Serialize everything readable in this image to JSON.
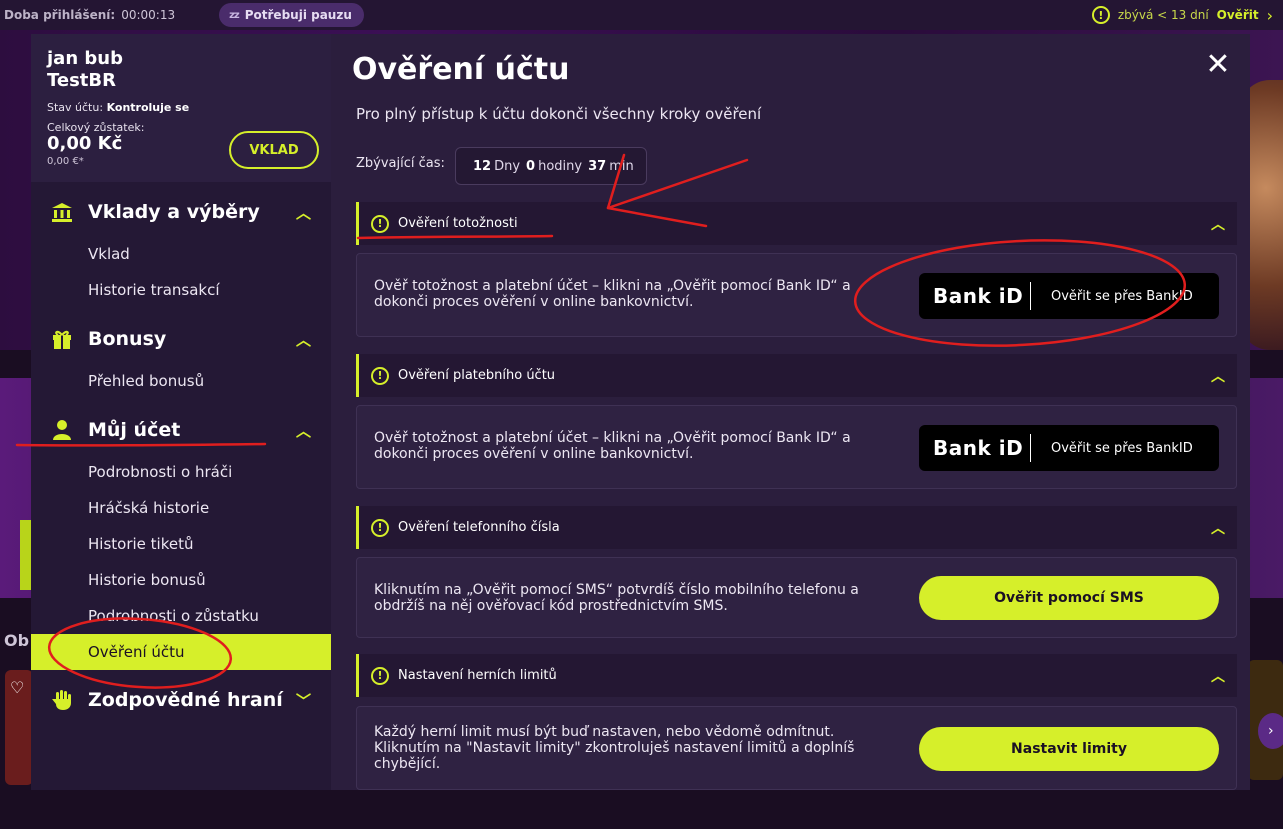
{
  "topbar": {
    "session_label": "Doba přihlášení:",
    "session_time": "00:00:13",
    "pause_icon": "zz",
    "pause_label": "Potřebuji pauzu",
    "remaining": "zbývá < 13 dní",
    "verify_label": "Ověřit"
  },
  "background": {
    "ob_text": "Ob"
  },
  "user": {
    "name_line1": "jan bub",
    "name_line2": "TestBR",
    "status_label": "Stav účtu:",
    "status_value": "Kontroluje se",
    "balance_label": "Celkový zůstatek:",
    "balance": "0,00 Kč",
    "balance_eur": "0,00 €*",
    "deposit_label": "VKLAD"
  },
  "sidebar": {
    "sections": [
      {
        "title": "Vklady a výběry",
        "icon": "bank-icon",
        "items": [
          "Vklad",
          "Historie transakcí"
        ]
      },
      {
        "title": "Bonusy",
        "icon": "gift-icon",
        "items": [
          "Přehled bonusů"
        ]
      },
      {
        "title": "Můj účet",
        "icon": "user-icon",
        "items": [
          "Podrobnosti o hráči",
          "Hráčská historie",
          "Historie tiketů",
          "Historie bonusů",
          "Podrobnosti o zůstatku",
          "Ověření účtu"
        ]
      },
      {
        "title": "Zodpovědné hraní",
        "icon": "hand-icon",
        "items": []
      }
    ],
    "active_item": "Ověření účtu"
  },
  "content": {
    "title": "Ověření účtu",
    "subtitle": "Pro plný přístup k účtu dokonči všechny kroky ověření",
    "time_label": "Zbývající čas:",
    "time": {
      "days": "12",
      "days_unit": "Dny",
      "hours": "0",
      "hours_unit": "hodiny",
      "minutes": "37",
      "minutes_unit": "min"
    },
    "steps": [
      {
        "title": "Ověření totožnosti",
        "text": "Ověř totožnost a platební účet – klikni na „Ověřit pomocí Bank ID“ a dokonči proces ověření v online bankovnictví.",
        "button_type": "bankid",
        "bankid_logo": "Bank iD",
        "button_label": "Ověřit se přes BankID"
      },
      {
        "title": "Ověření platebního účtu",
        "text": "Ověř totožnost a platební účet – klikni na „Ověřit pomocí Bank ID“ a dokonči proces ověření v online bankovnictví.",
        "button_type": "bankid",
        "bankid_logo": "Bank iD",
        "button_label": "Ověřit se přes BankID"
      },
      {
        "title": "Ověření telefonního čísla",
        "text": "Kliknutím na „Ověřit pomocí SMS“ potvrdíš číslo mobilního telefonu a obdržíš na něj ověřovací kód prostřednictvím SMS.",
        "button_type": "lime",
        "button_label": "Ověřit pomocí SMS"
      },
      {
        "title": "Nastavení herních limitů",
        "text": "Každý herní limit musí být buď nastaven, nebo vědomě odmítnut. Kliknutím na \"Nastavit limity\" zkontroluješ nastavení limitů a doplníš chybějící.",
        "button_type": "lime",
        "button_label": "Nastavit limity"
      }
    ]
  },
  "colors": {
    "accent": "#d6ef2a",
    "annotation": "#e01e1e",
    "panel": "#2b1e3d",
    "sidebar": "#241835"
  }
}
